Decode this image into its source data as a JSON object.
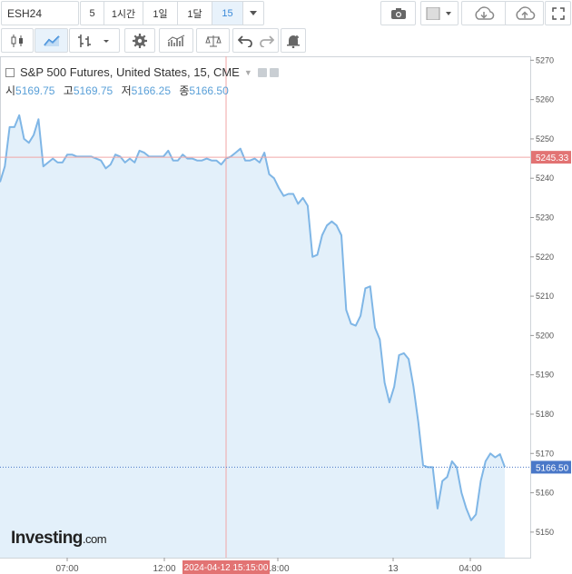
{
  "toolbar": {
    "symbol": "ESH24",
    "intervals": [
      {
        "label": "5",
        "active": false
      },
      {
        "label": "1시간",
        "active": false
      },
      {
        "label": "1일",
        "active": false
      },
      {
        "label": "1달",
        "active": false
      },
      {
        "label": "15",
        "active": true
      }
    ],
    "icons_row1": [
      "camera-icon",
      "square-icon",
      "cloud-download-icon",
      "cloud-upload-icon",
      "fullscreen-icon"
    ],
    "icons_row2": [
      "candlestick-icon",
      "line-chart-icon",
      "bar-chart-icon",
      "settings-icon",
      "indicators-icon",
      "compare-icon",
      "undo-icon",
      "redo-icon",
      "alert-icon"
    ]
  },
  "legend": {
    "title": "S&P 500 Futures, United States, 15, CME",
    "open_label": "시",
    "open_value": "5169.75",
    "high_label": "고",
    "high_value": "5169.75",
    "low_label": "저",
    "low_value": "5166.25",
    "close_label": "종",
    "close_value": "5166.50"
  },
  "logo": {
    "main": "Investing",
    "suffix": ".com"
  },
  "colors": {
    "line": "#7fb6e6",
    "fill": "#e3f0fa",
    "crosshair": "#f0a6a6",
    "price_tag_crosshair": "#e27373",
    "price_tag_last": "#4a78c8"
  },
  "chart_data": {
    "type": "area",
    "ylim": [
      5143.5,
      5271
    ],
    "y_ticks": [
      5150,
      5160,
      5170,
      5180,
      5190,
      5200,
      5210,
      5220,
      5230,
      5240,
      5250,
      5260,
      5270
    ],
    "x_tick_labels": [
      "07:00",
      "12:00",
      "18:00",
      "13",
      "04:00"
    ],
    "crosshair": {
      "time_label": "2024-04-12 15:15:00",
      "price_label": "5245.33"
    },
    "last_price_label": "5166.50",
    "values": [
      5239,
      5243,
      5253,
      5253,
      5256,
      5250,
      5249,
      5251,
      5255,
      5243,
      5244,
      5245,
      5244,
      5244,
      5246,
      5246,
      5245.5,
      5245.5,
      5245.5,
      5245.5,
      5245,
      5244.5,
      5242.5,
      5243.5,
      5246,
      5245.5,
      5244,
      5245,
      5244,
      5247,
      5246.5,
      5245.5,
      5245.5,
      5245.5,
      5245.5,
      5247,
      5244.5,
      5244.5,
      5246,
      5245,
      5245,
      5244.5,
      5244.5,
      5245,
      5244.5,
      5244.5,
      5243.5,
      5245,
      5245.5,
      5246.5,
      5247.5,
      5244.5,
      5244.5,
      5245,
      5244,
      5246.5,
      5241,
      5240,
      5237.5,
      5235.5,
      5236,
      5236,
      5233.5,
      5235,
      5233,
      5220,
      5220.5,
      5225.5,
      5228,
      5229,
      5228,
      5225.5,
      5206.5,
      5203,
      5202.5,
      5205,
      5212,
      5212.5,
      5202,
      5199,
      5188,
      5183,
      5187,
      5195,
      5195.5,
      5194,
      5187,
      5178,
      5167,
      5166.5,
      5166.5,
      5156,
      5163,
      5164,
      5168,
      5166.5,
      5160,
      5156,
      5153,
      5154.5,
      5163,
      5168,
      5170,
      5169,
      5169.8,
      5166.5
    ]
  }
}
